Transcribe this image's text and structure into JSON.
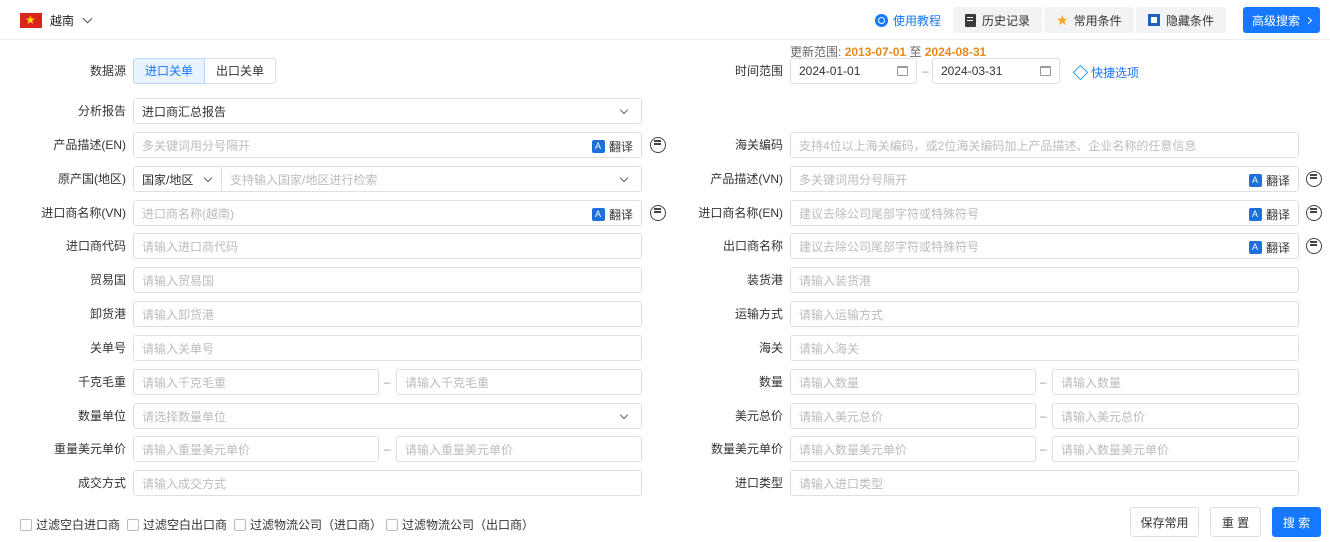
{
  "header": {
    "country": "越南",
    "tutorial": "使用教程",
    "history": "历史记录",
    "common_conditions": "常用条件",
    "hide_conditions": "隐藏条件",
    "advanced_search": "高级搜索"
  },
  "update_range": {
    "label": "更新范围:",
    "start": "2013-07-01",
    "sep": "至",
    "end": "2024-08-31"
  },
  "data_source": {
    "label": "数据源",
    "options": [
      "进口关单",
      "出口关单"
    ],
    "selected": "进口关单"
  },
  "time_range": {
    "label": "时间范围",
    "start": "2024-01-01",
    "end": "2024-03-31",
    "quick": "快捷选项"
  },
  "report": {
    "label": "分析报告",
    "value": "进口商汇总报告"
  },
  "translate_label": "翻译",
  "range_sep": "–",
  "left_fields": {
    "product_desc_en": {
      "label": "产品描述(EN)",
      "placeholder": "多关键词用分号隔开"
    },
    "origin_country": {
      "label": "原产国(地区)",
      "selector": "国家/地区",
      "placeholder": "支持输入国家/地区进行检索"
    },
    "importer_vn": {
      "label": "进口商名称(VN)",
      "placeholder": "进口商名称(越南)"
    },
    "importer_code": {
      "label": "进口商代码",
      "placeholder": "请输入进口商代码"
    },
    "trade_country": {
      "label": "贸易国",
      "placeholder": "请输入贸易国"
    },
    "discharge_port": {
      "label": "卸货港",
      "placeholder": "请输入卸货港"
    },
    "customs_no": {
      "label": "关单号",
      "placeholder": "请输入关单号"
    },
    "gross_weight": {
      "label": "千克毛重",
      "placeholder_min": "请输入千克毛重",
      "placeholder_max": "请输入千克毛重"
    },
    "quantity_unit": {
      "label": "数量单位",
      "placeholder": "请选择数量单位"
    },
    "weight_usd_price": {
      "label": "重量美元单价",
      "placeholder_min": "请输入重量美元单价",
      "placeholder_max": "请输入重量美元单价"
    },
    "deal_method": {
      "label": "成交方式",
      "placeholder": "请输入成交方式"
    }
  },
  "right_fields": {
    "hs_code": {
      "label": "海关编码",
      "placeholder": "支持4位以上海关编码，或2位海关编码加上产品描述、企业名称的任意信息"
    },
    "product_desc_vn": {
      "label": "产品描述(VN)",
      "placeholder": "多关键词用分号隔开"
    },
    "importer_en": {
      "label": "进口商名称(EN)",
      "placeholder": "建议去除公司尾部字符或特殊符号"
    },
    "exporter": {
      "label": "出口商名称",
      "placeholder": "建议去除公司尾部字符或特殊符号"
    },
    "loading_port": {
      "label": "装货港",
      "placeholder": "请输入装货港"
    },
    "transport": {
      "label": "运输方式",
      "placeholder": "请输入运输方式"
    },
    "customs": {
      "label": "海关",
      "placeholder": "请输入海关"
    },
    "quantity": {
      "label": "数量",
      "placeholder_min": "请输入数量",
      "placeholder_max": "请输入数量"
    },
    "usd_total": {
      "label": "美元总价",
      "placeholder_min": "请输入美元总价",
      "placeholder_max": "请输入美元总价"
    },
    "qty_usd_price": {
      "label": "数量美元单价",
      "placeholder_min": "请输入数量美元单价",
      "placeholder_max": "请输入数量美元单价"
    },
    "import_type": {
      "label": "进口类型",
      "placeholder": "请输入进口类型"
    }
  },
  "footer": {
    "filters": [
      "过滤空白进口商",
      "过滤空白出口商",
      "过滤物流公司（进口商）",
      "过滤物流公司（出口商）"
    ],
    "save_common": "保存常用",
    "reset": "重 置",
    "search": "搜 索"
  }
}
